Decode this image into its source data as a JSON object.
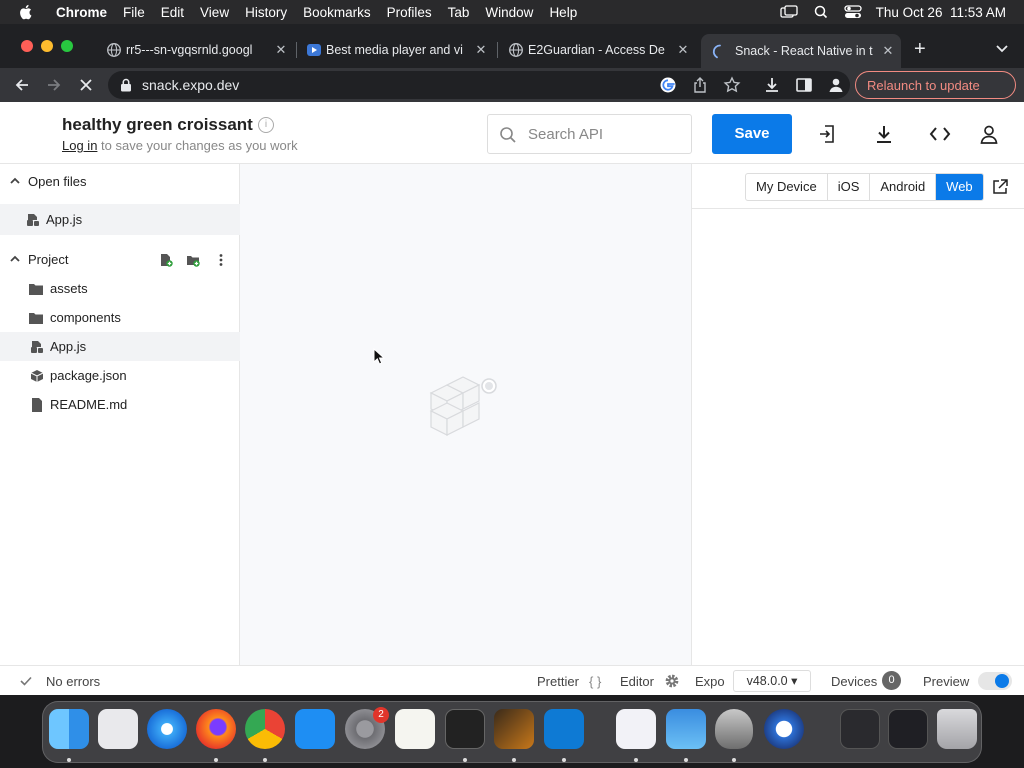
{
  "menubar": {
    "app": "Chrome",
    "items": [
      "File",
      "Edit",
      "View",
      "History",
      "Bookmarks",
      "Profiles",
      "Tab",
      "Window",
      "Help"
    ],
    "clock": "Thu Oct 26  11:53 AM"
  },
  "tabs": [
    {
      "title": "rr5---sn-vgqsrnld.googl",
      "icon": "globe-icon"
    },
    {
      "title": "Best media player and vi",
      "icon": "media-player-icon"
    },
    {
      "title": "E2Guardian - Access De",
      "icon": "globe-icon"
    },
    {
      "title": "Snack - React Native in t",
      "icon": "loading-spinner-icon"
    }
  ],
  "address": {
    "url": "snack.expo.dev",
    "relaunch": "Relaunch to update"
  },
  "header": {
    "project_name": "healthy green croissant",
    "login": "Log in",
    "login_suffix": " to save your changes as you work",
    "search_placeholder": "Search API",
    "save": "Save"
  },
  "sidebar": {
    "open_files_label": "Open files",
    "open_files": [
      "App.js"
    ],
    "project_label": "Project",
    "project_items": [
      {
        "label": "assets",
        "icon": "folder-icon"
      },
      {
        "label": "components",
        "icon": "folder-icon"
      },
      {
        "label": "App.js",
        "icon": "js-file-icon",
        "selected": true
      },
      {
        "label": "package.json",
        "icon": "package-icon"
      },
      {
        "label": "README.md",
        "icon": "document-icon"
      }
    ]
  },
  "preview": {
    "devices": [
      "My Device",
      "iOS",
      "Android",
      "Web"
    ],
    "selected": "Web"
  },
  "footer": {
    "errors": "No errors",
    "prettier": "Prettier",
    "prettier_icon": "{ }",
    "editor": "Editor",
    "expo": "Expo",
    "sdk_version": "v48.0.0 ▾",
    "devices": "Devices",
    "devices_count": "0",
    "preview": "Preview"
  },
  "colors": {
    "accent": "#0b7ae8",
    "relaunch": "#f28b82"
  },
  "dock": {
    "badge": "2",
    "apps": [
      "finder-icon",
      "launchpad-icon",
      "safari-icon",
      "firefox-icon",
      "chrome-icon",
      "app-store-icon",
      "system-settings-icon",
      "textedit-icon",
      "terminal-icon",
      "garageband-icon",
      "vscode-icon",
      "visual-studio-icon",
      "weather-icon",
      "rocket-icon",
      "quicktime-icon",
      "downloads-stack-icon",
      "screenshots-stack-icon",
      "trash-icon"
    ]
  }
}
